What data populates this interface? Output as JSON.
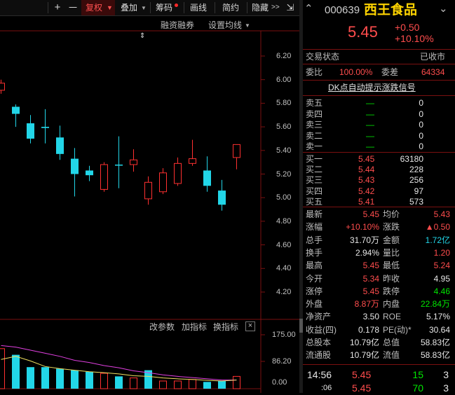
{
  "toolbar": {
    "plus": "+",
    "minus": "一",
    "fuquan": "复权",
    "diejia": "叠加",
    "chouma": "筹码",
    "huaxian": "画线",
    "jianyue": "简约",
    "yincang": "隐藏",
    "expand": "⇲"
  },
  "subbar": {
    "rongzi": "融资融券",
    "junxian": "设置均线"
  },
  "price_axis": [
    "6.20",
    "6.00",
    "5.80",
    "5.60",
    "5.40",
    "5.20",
    "5.00",
    "4.80",
    "4.60",
    "4.40",
    "4.20"
  ],
  "indicator_bar": {
    "param": "改参数",
    "add": "加指标",
    "switch": "换指标",
    "close": "×"
  },
  "vol_axis": [
    "175.00",
    "86.20",
    "0.00"
  ],
  "chart_data": {
    "type": "candlestick",
    "ylim": [
      4.12,
      6.28
    ],
    "candles": [
      {
        "o": 5.91,
        "c": 5.97,
        "h": 6.0,
        "l": 5.88,
        "up": true
      },
      {
        "o": 5.77,
        "c": 5.71,
        "h": 5.79,
        "l": 5.6,
        "up": false
      },
      {
        "o": 5.63,
        "c": 5.5,
        "h": 5.7,
        "l": 5.46,
        "up": false
      },
      {
        "o": 5.6,
        "c": 5.59,
        "h": 5.75,
        "l": 5.46,
        "up": false
      },
      {
        "o": 5.51,
        "c": 5.37,
        "h": 5.61,
        "l": 5.32,
        "up": false
      },
      {
        "o": 5.33,
        "c": 5.2,
        "h": 5.42,
        "l": 5.01,
        "up": false
      },
      {
        "o": 5.23,
        "c": 5.19,
        "h": 5.27,
        "l": 5.14,
        "up": false
      },
      {
        "o": 5.07,
        "c": 5.28,
        "h": 5.3,
        "l": 5.05,
        "up": true
      },
      {
        "o": 5.28,
        "c": 5.28,
        "h": 5.52,
        "l": 5.08,
        "up": false
      },
      {
        "o": 5.28,
        "c": 5.32,
        "h": 5.41,
        "l": 5.22,
        "up": true
      },
      {
        "o": 4.99,
        "c": 5.13,
        "h": 5.18,
        "l": 4.94,
        "up": true
      },
      {
        "o": 5.05,
        "c": 5.21,
        "h": 5.25,
        "l": 5.03,
        "up": true
      },
      {
        "o": 5.12,
        "c": 5.29,
        "h": 5.34,
        "l": 5.1,
        "up": true
      },
      {
        "o": 5.29,
        "c": 5.33,
        "h": 5.49,
        "l": 5.27,
        "up": true
      },
      {
        "o": 5.23,
        "c": 5.1,
        "h": 5.35,
        "l": 5.05,
        "up": false
      },
      {
        "o": 5.06,
        "c": 4.94,
        "h": 5.15,
        "l": 4.89,
        "up": false
      },
      {
        "o": 5.34,
        "c": 5.45,
        "h": 5.45,
        "l": 5.24,
        "up": true
      }
    ],
    "volumes": [
      {
        "v": 130,
        "up": true
      },
      {
        "v": 110,
        "up": false
      },
      {
        "v": 70,
        "up": false
      },
      {
        "v": 70,
        "up": false
      },
      {
        "v": 65,
        "up": false
      },
      {
        "v": 60,
        "up": false
      },
      {
        "v": 55,
        "up": false
      },
      {
        "v": 50,
        "up": true
      },
      {
        "v": 40,
        "up": false
      },
      {
        "v": 35,
        "up": true
      },
      {
        "v": 60,
        "up": false
      },
      {
        "v": 25,
        "up": true
      },
      {
        "v": 25,
        "up": true
      },
      {
        "v": 30,
        "up": true
      },
      {
        "v": 22,
        "up": false
      },
      {
        "v": 25,
        "up": false
      },
      {
        "v": 40,
        "up": true
      }
    ],
    "vol_ylim": [
      0,
      175
    ],
    "ma5": [
      95,
      105,
      90,
      72,
      65,
      60,
      55,
      52,
      48,
      42,
      40,
      35,
      32,
      30,
      27,
      25,
      28
    ],
    "ma10": [
      140,
      135,
      125,
      115,
      105,
      92,
      85,
      75,
      68,
      58,
      52,
      45,
      40,
      36,
      32,
      28,
      28
    ]
  },
  "stock": {
    "code": "000639",
    "name": "西王食品",
    "price": "5.45",
    "change": "+0.50",
    "pct": "+10.10%"
  },
  "status": {
    "label": "交易状态",
    "value": "已收市"
  },
  "weibi": {
    "label1": "委比",
    "value1": "100.00%",
    "label2": "委差",
    "value2": "64334"
  },
  "dk_link": "DK点自动提示涨跌信号",
  "asks": [
    {
      "label": "卖五",
      "price": "—",
      "vol": "0"
    },
    {
      "label": "卖四",
      "price": "—",
      "vol": "0"
    },
    {
      "label": "卖三",
      "price": "—",
      "vol": "0"
    },
    {
      "label": "卖二",
      "price": "—",
      "vol": "0"
    },
    {
      "label": "卖一",
      "price": "—",
      "vol": "0"
    }
  ],
  "bids": [
    {
      "label": "买一",
      "price": "5.45",
      "vol": "63180"
    },
    {
      "label": "买二",
      "price": "5.44",
      "vol": "228"
    },
    {
      "label": "买三",
      "price": "5.43",
      "vol": "256"
    },
    {
      "label": "买四",
      "price": "5.42",
      "vol": "97"
    },
    {
      "label": "买五",
      "price": "5.41",
      "vol": "573"
    }
  ],
  "stats": [
    {
      "l1": "最新",
      "v1": "5.45",
      "c1": "red",
      "l2": "均价",
      "v2": "5.43",
      "c2": "red"
    },
    {
      "l1": "涨幅",
      "v1": "+10.10%",
      "c1": "red",
      "l2": "涨跌",
      "v2": "▲0.50",
      "c2": "red"
    },
    {
      "l1": "总手",
      "v1": "31.70万",
      "c1": "white",
      "l2": "金额",
      "v2": "1.72亿",
      "c2": "cyan"
    },
    {
      "l1": "换手",
      "v1": "2.94%",
      "c1": "white",
      "l2": "量比",
      "v2": "1.20",
      "c2": "red"
    },
    {
      "l1": "最高",
      "v1": "5.45",
      "c1": "red",
      "l2": "最低",
      "v2": "5.24",
      "c2": "red"
    },
    {
      "l1": "今开",
      "v1": "5.34",
      "c1": "red",
      "l2": "昨收",
      "v2": "4.95",
      "c2": "white"
    },
    {
      "l1": "涨停",
      "v1": "5.45",
      "c1": "red",
      "l2": "跌停",
      "v2": "4.46",
      "c2": "green"
    },
    {
      "l1": "外盘",
      "v1": "8.87万",
      "c1": "red",
      "l2": "内盘",
      "v2": "22.84万",
      "c2": "green"
    },
    {
      "l1": "净资产",
      "v1": "3.50",
      "c1": "white",
      "l2": "ROE",
      "v2": "5.17%",
      "c2": "white"
    },
    {
      "l1": "收益(四)",
      "v1": "0.178",
      "c1": "white",
      "l2": "PE(动)*",
      "v2": "30.64",
      "c2": "white"
    },
    {
      "l1": "总股本",
      "v1": "10.79亿",
      "c1": "white",
      "l2": "总值",
      "v2": "58.83亿",
      "c2": "white"
    },
    {
      "l1": "流通股",
      "v1": "10.79亿",
      "c1": "white",
      "l2": "流值",
      "v2": "58.83亿",
      "c2": "white"
    }
  ],
  "ticks": [
    {
      "time": "14:56",
      "price": "5.45",
      "vol": "15",
      "num": "3"
    },
    {
      "time": ":06",
      "price": "5.45",
      "vol": "70",
      "num": "3"
    }
  ],
  "colors": {
    "up": "#ff3030",
    "down": "#22d6e8",
    "grid": "#7a1010",
    "ma5": "#ffffff",
    "ma10": "#e040e0"
  }
}
